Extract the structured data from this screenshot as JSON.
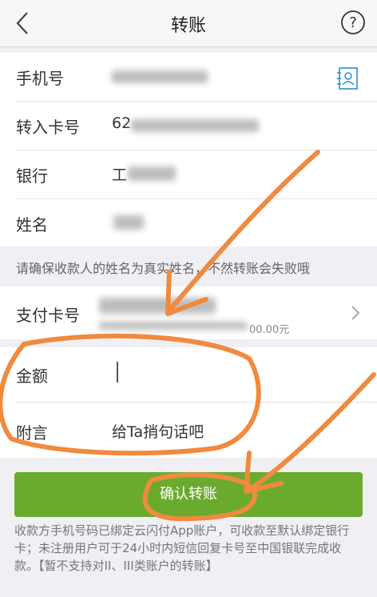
{
  "header": {
    "title": "转账",
    "back_icon": "chevron-left-icon",
    "help_icon": "question-circle-icon"
  },
  "form": {
    "phone_label": "手机号",
    "phone_value": "",
    "contact_icon": "contact-book-icon",
    "card_label": "转入卡号",
    "card_value_prefix": "62",
    "bank_label": "银行",
    "bank_value_prefix": "工",
    "name_label": "姓名",
    "name_value": ""
  },
  "notice": "请确保收款人的姓名为真实姓名，不然转账会失败哦",
  "payment": {
    "label": "支付卡号",
    "balance_suffix": "00.00元",
    "chevron_icon": "chevron-right-icon"
  },
  "amount": {
    "label": "金额",
    "value": ""
  },
  "memo": {
    "label": "附言",
    "placeholder": "给Ta捎句话吧"
  },
  "confirm_label": "确认转账",
  "footer_text": "收款方手机号码已绑定云闪付App账户，可收款至默认绑定银行卡；未注册用户可于24小时内短信回复卡号至中国银联完成收款。【暂不支持对II、III类账户的转账】",
  "colors": {
    "primary": "#6aab2e",
    "annotation": "#f08a3e",
    "accent": "#2f8fd0"
  }
}
